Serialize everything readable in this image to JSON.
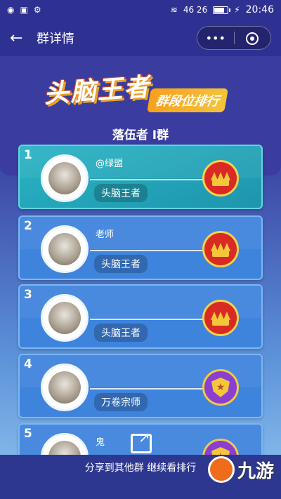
{
  "status_bar": {
    "signal": "46 26",
    "time": "20:46"
  },
  "nav": {
    "title": "群详情",
    "capsule_more": "•••"
  },
  "header": {
    "logo_main": "头脑王者",
    "logo_sub": "群段位排行",
    "group_name": "落伍者 I群"
  },
  "ranks": [
    {
      "num": "1",
      "name": "@绿盟",
      "title": "头脑王者",
      "badge": "crown"
    },
    {
      "num": "2",
      "name": "老师",
      "title": "头脑王者",
      "badge": "crown"
    },
    {
      "num": "3",
      "name": "",
      "title": "头脑王者",
      "badge": "crown"
    },
    {
      "num": "4",
      "name": "",
      "title": "万卷宗师",
      "badge": "shield"
    },
    {
      "num": "5",
      "name": "鬼",
      "title": "",
      "badge": "shield"
    }
  ],
  "footer": {
    "share_label": "分享到其他群 继续看排行",
    "watermark": "九游"
  }
}
